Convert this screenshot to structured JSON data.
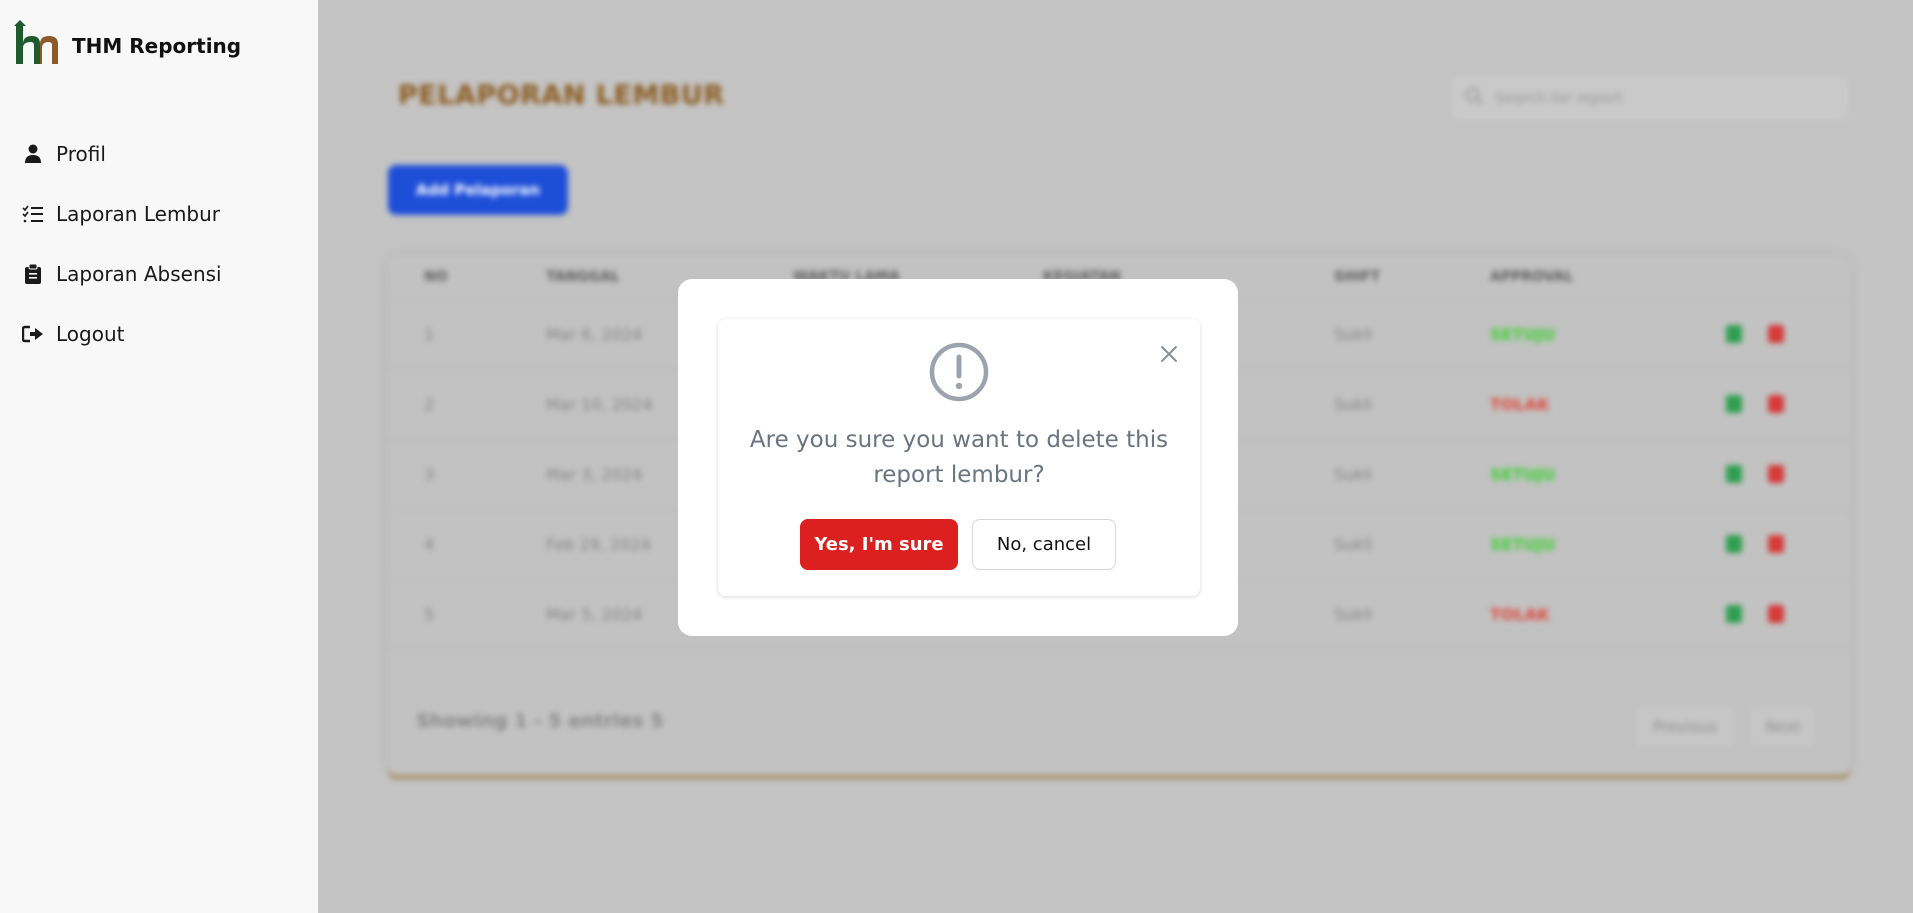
{
  "app": {
    "title": "THM Reporting"
  },
  "sidebar": {
    "items": [
      {
        "label": "Profil",
        "icon": "user-icon"
      },
      {
        "label": "Laporan Lembur",
        "icon": "checklist-icon"
      },
      {
        "label": "Laporan Absensi",
        "icon": "clipboard-icon"
      },
      {
        "label": "Logout",
        "icon": "logout-icon"
      }
    ]
  },
  "page": {
    "title": "PELAPORAN LEMBUR",
    "search_placeholder": "Search for report",
    "add_button": "Add Pelaporan"
  },
  "table": {
    "headers": [
      "NO",
      "TANGGAL",
      "WAKTU LAMA",
      "KEGIATAN",
      "SHIFT",
      "APPROVAL"
    ],
    "rows": [
      {
        "no": "1",
        "tanggal": "Mar 6, 2024",
        "shift": "Sukli",
        "approval": "SETUJU",
        "status": "approved"
      },
      {
        "no": "2",
        "tanggal": "Mar 10, 2024",
        "shift": "Sukli",
        "approval": "TOLAK",
        "status": "rejected"
      },
      {
        "no": "3",
        "tanggal": "Mar 3, 2024",
        "shift": "Sukli",
        "approval": "SETUJU",
        "status": "approved"
      },
      {
        "no": "4",
        "tanggal": "Feb 29, 2024",
        "shift": "Sukli",
        "approval": "SETUJU",
        "status": "approved"
      },
      {
        "no": "5",
        "tanggal": "Mar 5, 2024",
        "shift": "Sukli",
        "approval": "TOLAK",
        "status": "rejected"
      }
    ],
    "footer": "Showing 1 - 5 entries 5",
    "prev_label": "Previous",
    "next_label": "Next"
  },
  "modal": {
    "message": "Are you sure you want to delete this report lembur?",
    "confirm_label": "Yes, I'm sure",
    "cancel_label": "No, cancel"
  },
  "colors": {
    "accent_blue": "#1d4ed8",
    "danger": "#dc2020",
    "approved": "#3bd02f",
    "rejected": "#e0473b",
    "title_brown": "#8a5a1f"
  }
}
